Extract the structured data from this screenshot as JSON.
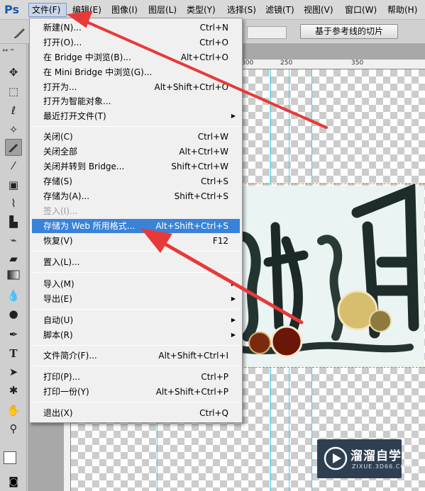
{
  "app": {
    "logo": "Ps"
  },
  "menubar": [
    {
      "label": "文件(F)"
    },
    {
      "label": "编辑(E)"
    },
    {
      "label": "图像(I)"
    },
    {
      "label": "图层(L)"
    },
    {
      "label": "类型(Y)"
    },
    {
      "label": "选择(S)"
    },
    {
      "label": "滤镜(T)"
    },
    {
      "label": "视图(V)"
    },
    {
      "label": "窗口(W)"
    },
    {
      "label": "帮助(H)"
    }
  ],
  "options": {
    "guide_slices_label": "基于参考线的切片"
  },
  "toolbox": {
    "tools": [
      "move-tool-icon",
      "marquee-tool-icon",
      "lasso-tool-icon",
      "magic-wand-icon",
      "slice-tool-icon",
      "eyedropper-icon",
      "healing-brush-icon",
      "brush-icon",
      "clone-stamp-icon",
      "history-brush-icon",
      "eraser-icon",
      "gradient-icon",
      "blur-icon",
      "dodge-icon",
      "pen-icon",
      "type-tool-icon",
      "path-select-icon",
      "custom-shape-icon",
      "hand-icon",
      "zoom-icon"
    ],
    "active": "slice-tool-icon",
    "fg_color": "#ffffff",
    "bg_color": "#8db0d8"
  },
  "ruler": {
    "ticks": [
      "300",
      "250",
      "350"
    ]
  },
  "file_menu": {
    "items": [
      {
        "label": "新建(N)...",
        "shortcut": "Ctrl+N"
      },
      {
        "label": "打开(O)...",
        "shortcut": "Ctrl+O"
      },
      {
        "label": "在 Bridge 中浏览(B)...",
        "shortcut": "Alt+Ctrl+O"
      },
      {
        "label": "在 Mini Bridge 中浏览(G)...",
        "shortcut": ""
      },
      {
        "label": "打开为...",
        "shortcut": "Alt+Shift+Ctrl+O"
      },
      {
        "label": "打开为智能对象...",
        "shortcut": ""
      },
      {
        "label": "最近打开文件(T)",
        "shortcut": "",
        "submenu": true
      },
      {
        "label": "关闭(C)",
        "shortcut": "Ctrl+W"
      },
      {
        "label": "关闭全部",
        "shortcut": "Alt+Ctrl+W"
      },
      {
        "label": "关闭并转到 Bridge...",
        "shortcut": "Shift+Ctrl+W"
      },
      {
        "label": "存储(S)",
        "shortcut": "Ctrl+S"
      },
      {
        "label": "存储为(A)...",
        "shortcut": "Shift+Ctrl+S"
      },
      {
        "label": "签入(I)...",
        "shortcut": "",
        "disabled": true
      },
      {
        "label": "存储为 Web 所用格式...",
        "shortcut": "Alt+Shift+Ctrl+S",
        "highlighted": true
      },
      {
        "label": "恢复(V)",
        "shortcut": "F12"
      },
      {
        "label": "置入(L)...",
        "shortcut": ""
      },
      {
        "label": "导入(M)",
        "shortcut": "",
        "submenu": true
      },
      {
        "label": "导出(E)",
        "shortcut": "",
        "submenu": true
      },
      {
        "label": "自动(U)",
        "shortcut": "",
        "submenu": true
      },
      {
        "label": "脚本(R)",
        "shortcut": "",
        "submenu": true
      },
      {
        "label": "文件简介(F)...",
        "shortcut": "Alt+Shift+Ctrl+I"
      },
      {
        "label": "打印(P)...",
        "shortcut": "Ctrl+P"
      },
      {
        "label": "打印一份(Y)",
        "shortcut": "Alt+Shift+Ctrl+P"
      },
      {
        "label": "退出(X)",
        "shortcut": "Ctrl+Q"
      }
    ]
  },
  "watermark": {
    "title": "溜溜自学",
    "url": "ZIXUE.3D66.COM"
  },
  "colors": {
    "highlight": "#3a82d8",
    "annotation_arrow": "#e8393a",
    "guide": "#47d3e0"
  }
}
